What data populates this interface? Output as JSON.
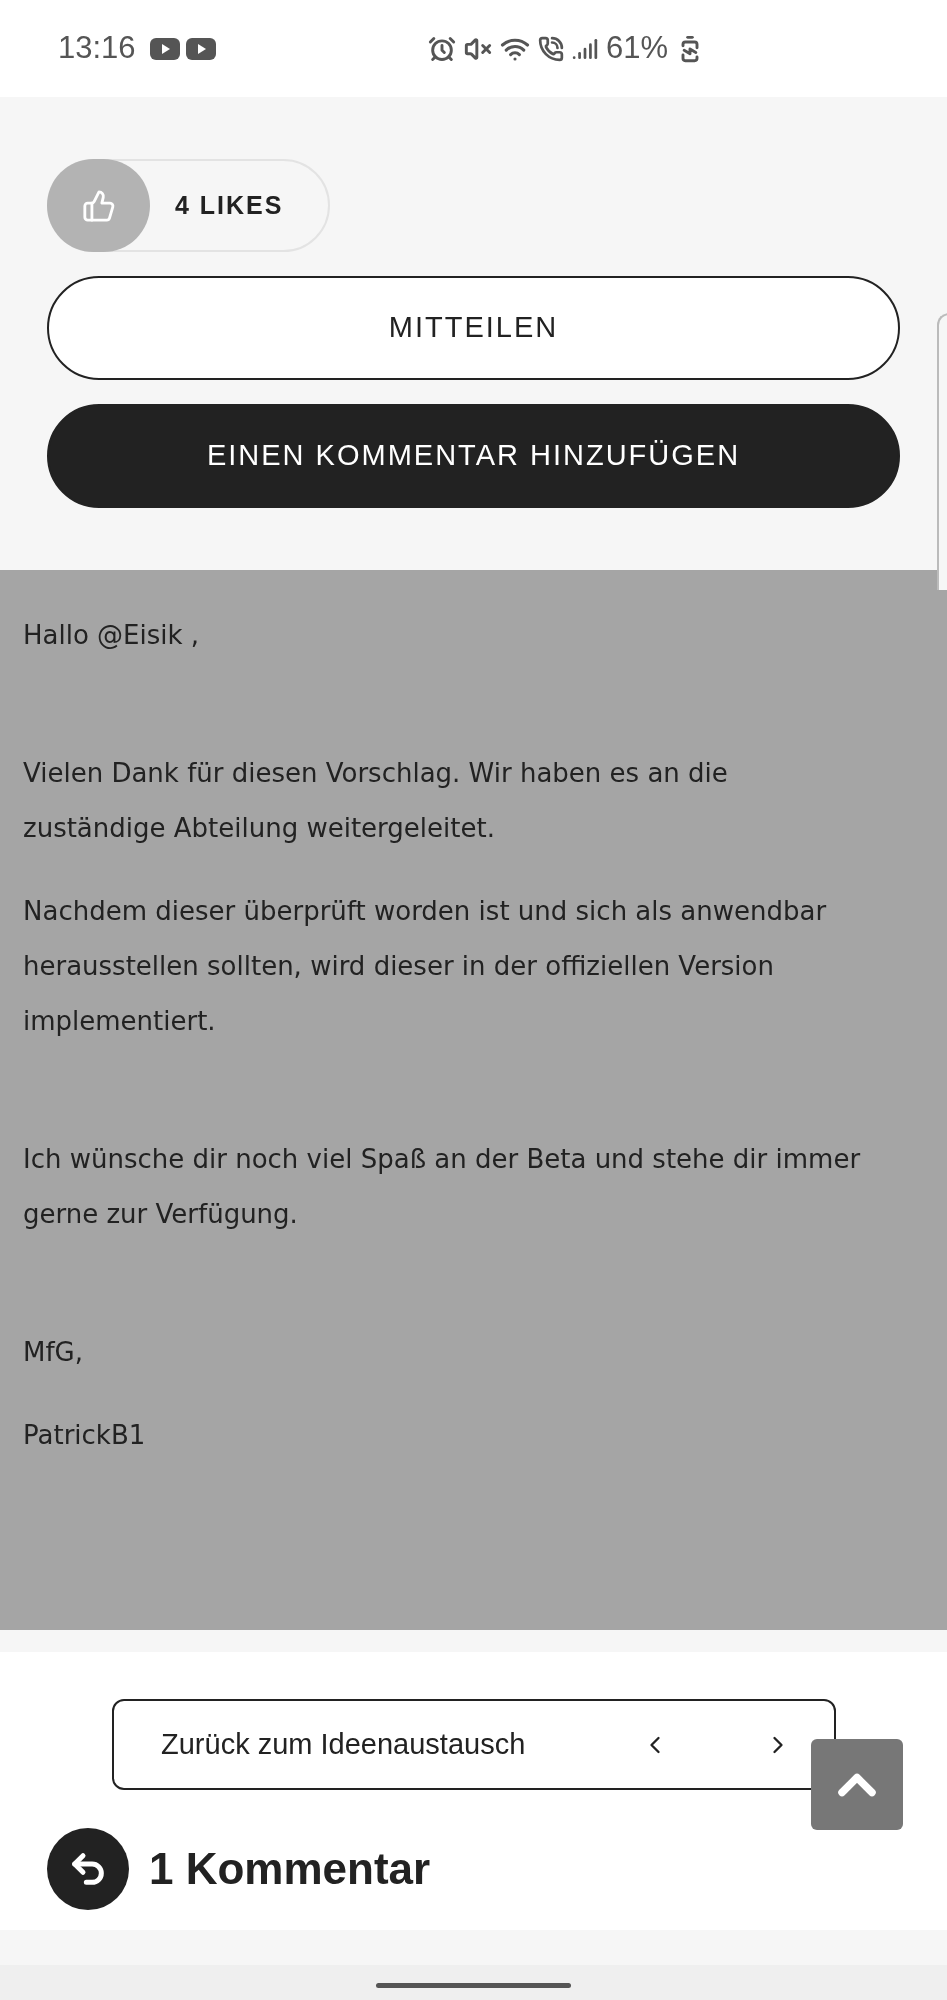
{
  "status_bar": {
    "time": "13:16",
    "battery": "61%"
  },
  "likes": {
    "label": "4 LIKES"
  },
  "buttons": [
    {
      "label": "MITTEILEN",
      "kind": "outline"
    },
    {
      "label": "EINEN KOMMENTAR HINZUFÜGEN",
      "kind": "filled"
    }
  ],
  "reply": {
    "blocks": [
      [
        "Hallo @Eisik ,"
      ],
      [
        "Vielen Dank für diesen Vorschlag. Wir haben es an die zuständige Abteilung weitergeleitet.",
        "Nachdem dieser überprüft worden ist und sich als anwendbar herausstellen sollten, wird dieser in der offiziellen Version implementiert."
      ],
      [
        "Ich wünsche dir noch viel Spaß an der Beta und stehe dir immer gerne zur Verfügung."
      ],
      [
        "MfG,",
        "PatrickB1"
      ]
    ]
  },
  "navigation": {
    "label": "Zurück zum Ideenaustausch"
  },
  "comments": {
    "title": "1 Kommentar"
  }
}
